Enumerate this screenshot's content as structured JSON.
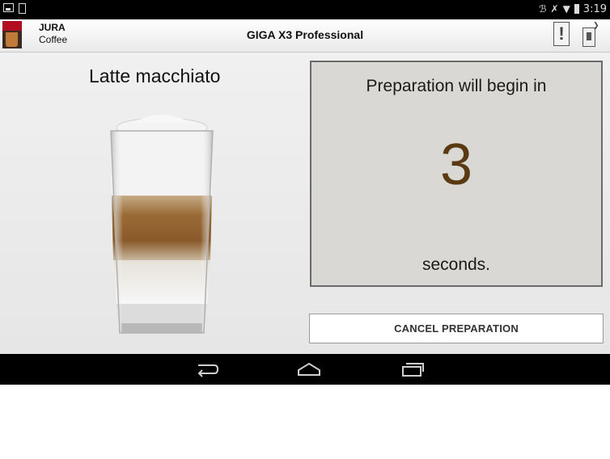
{
  "status_bar": {
    "time": "3:19",
    "icons": [
      "image-icon",
      "download-icon",
      "bluetooth-icon",
      "mute-icon",
      "wifi-icon",
      "battery-icon"
    ]
  },
  "app_bar": {
    "brand_name": "JURA",
    "brand_sub": "Coffee",
    "title": "GIGA X3 Professional",
    "warning_glyph": "!",
    "icons": [
      "jura-logo-icon",
      "warning-icon",
      "machine-connection-icon"
    ]
  },
  "product": {
    "name": "Latte macchiato",
    "image": "latte-macchiato-glass"
  },
  "preparation": {
    "intro": "Preparation will begin in",
    "countdown": "3",
    "unit": "seconds.",
    "countdown_color": "#5a3a12"
  },
  "actions": {
    "cancel_label": "CANCEL PREPARATION"
  },
  "nav_bar": {
    "icons": [
      "back-icon",
      "home-icon",
      "recent-apps-icon"
    ]
  }
}
